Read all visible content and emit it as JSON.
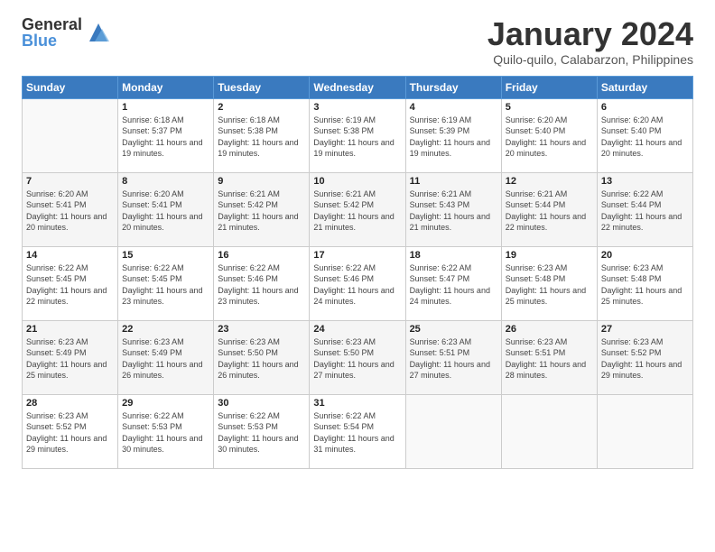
{
  "logo": {
    "general": "General",
    "blue": "Blue"
  },
  "header": {
    "title": "January 2024",
    "subtitle": "Quilo-quilo, Calabarzon, Philippines"
  },
  "weekdays": [
    "Sunday",
    "Monday",
    "Tuesday",
    "Wednesday",
    "Thursday",
    "Friday",
    "Saturday"
  ],
  "weeks": [
    [
      {
        "day": "",
        "info": ""
      },
      {
        "day": "1",
        "info": "Sunrise: 6:18 AM\nSunset: 5:37 PM\nDaylight: 11 hours\nand 19 minutes."
      },
      {
        "day": "2",
        "info": "Sunrise: 6:18 AM\nSunset: 5:38 PM\nDaylight: 11 hours\nand 19 minutes."
      },
      {
        "day": "3",
        "info": "Sunrise: 6:19 AM\nSunset: 5:38 PM\nDaylight: 11 hours\nand 19 minutes."
      },
      {
        "day": "4",
        "info": "Sunrise: 6:19 AM\nSunset: 5:39 PM\nDaylight: 11 hours\nand 19 minutes."
      },
      {
        "day": "5",
        "info": "Sunrise: 6:20 AM\nSunset: 5:40 PM\nDaylight: 11 hours\nand 20 minutes."
      },
      {
        "day": "6",
        "info": "Sunrise: 6:20 AM\nSunset: 5:40 PM\nDaylight: 11 hours\nand 20 minutes."
      }
    ],
    [
      {
        "day": "7",
        "info": ""
      },
      {
        "day": "8",
        "info": "Sunrise: 6:20 AM\nSunset: 5:41 PM\nDaylight: 11 hours\nand 20 minutes."
      },
      {
        "day": "9",
        "info": "Sunrise: 6:21 AM\nSunset: 5:42 PM\nDaylight: 11 hours\nand 21 minutes."
      },
      {
        "day": "10",
        "info": "Sunrise: 6:21 AM\nSunset: 5:42 PM\nDaylight: 11 hours\nand 21 minutes."
      },
      {
        "day": "11",
        "info": "Sunrise: 6:21 AM\nSunset: 5:43 PM\nDaylight: 11 hours\nand 21 minutes."
      },
      {
        "day": "12",
        "info": "Sunrise: 6:21 AM\nSunset: 5:44 PM\nDaylight: 11 hours\nand 22 minutes."
      },
      {
        "day": "13",
        "info": "Sunrise: 6:22 AM\nSunset: 5:44 PM\nDaylight: 11 hours\nand 22 minutes."
      }
    ],
    [
      {
        "day": "14",
        "info": ""
      },
      {
        "day": "15",
        "info": "Sunrise: 6:22 AM\nSunset: 5:45 PM\nDaylight: 11 hours\nand 23 minutes."
      },
      {
        "day": "16",
        "info": "Sunrise: 6:22 AM\nSunset: 5:46 PM\nDaylight: 11 hours\nand 23 minutes."
      },
      {
        "day": "17",
        "info": "Sunrise: 6:22 AM\nSunset: 5:46 PM\nDaylight: 11 hours\nand 24 minutes."
      },
      {
        "day": "18",
        "info": "Sunrise: 6:22 AM\nSunset: 5:47 PM\nDaylight: 11 hours\nand 24 minutes."
      },
      {
        "day": "19",
        "info": "Sunrise: 6:23 AM\nSunset: 5:48 PM\nDaylight: 11 hours\nand 25 minutes."
      },
      {
        "day": "20",
        "info": "Sunrise: 6:23 AM\nSunset: 5:48 PM\nDaylight: 11 hours\nand 25 minutes."
      }
    ],
    [
      {
        "day": "21",
        "info": ""
      },
      {
        "day": "22",
        "info": "Sunrise: 6:23 AM\nSunset: 5:49 PM\nDaylight: 11 hours\nand 26 minutes."
      },
      {
        "day": "23",
        "info": "Sunrise: 6:23 AM\nSunset: 5:50 PM\nDaylight: 11 hours\nand 26 minutes."
      },
      {
        "day": "24",
        "info": "Sunrise: 6:23 AM\nSunset: 5:50 PM\nDaylight: 11 hours\nand 27 minutes."
      },
      {
        "day": "25",
        "info": "Sunrise: 6:23 AM\nSunset: 5:51 PM\nDaylight: 11 hours\nand 27 minutes."
      },
      {
        "day": "26",
        "info": "Sunrise: 6:23 AM\nSunset: 5:51 PM\nDaylight: 11 hours\nand 28 minutes."
      },
      {
        "day": "27",
        "info": "Sunrise: 6:23 AM\nSunset: 5:52 PM\nDaylight: 11 hours\nand 29 minutes."
      }
    ],
    [
      {
        "day": "28",
        "info": "Sunrise: 6:23 AM\nSunset: 5:52 PM\nDaylight: 11 hours\nand 29 minutes."
      },
      {
        "day": "29",
        "info": "Sunrise: 6:22 AM\nSunset: 5:53 PM\nDaylight: 11 hours\nand 30 minutes."
      },
      {
        "day": "30",
        "info": "Sunrise: 6:22 AM\nSunset: 5:53 PM\nDaylight: 11 hours\nand 30 minutes."
      },
      {
        "day": "31",
        "info": "Sunrise: 6:22 AM\nSunset: 5:54 PM\nDaylight: 11 hours\nand 31 minutes."
      },
      {
        "day": "",
        "info": ""
      },
      {
        "day": "",
        "info": ""
      },
      {
        "day": "",
        "info": ""
      }
    ]
  ],
  "week7_sunday": "Sunrise: 6:20 AM\nSunset: 5:41 PM\nDaylight: 11 hours\nand 20 minutes.",
  "week14_sunday": "Sunrise: 6:22 AM\nSunset: 5:45 PM\nDaylight: 11 hours\nand 22 minutes.",
  "week21_sunday": "Sunrise: 6:23 AM\nSunset: 5:49 PM\nDaylight: 11 hours\nand 25 minutes."
}
